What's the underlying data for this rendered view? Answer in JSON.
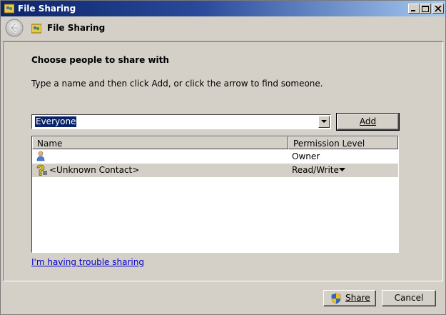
{
  "window": {
    "title": "File Sharing"
  },
  "nav": {
    "title": "File Sharing"
  },
  "content": {
    "heading": "Choose people to share with",
    "instruction": "Type a name and then click Add, or click the arrow to find someone.",
    "combo_value": "Everyone",
    "add_label": "Add"
  },
  "table": {
    "columns": [
      "Name",
      "Permission Level"
    ],
    "rows": [
      {
        "name": "",
        "permission": "Owner",
        "icon": "user-icon"
      },
      {
        "name": "<Unknown Contact>",
        "permission": "Read/Write",
        "icon": "unknown-contact-icon"
      }
    ]
  },
  "help_link": "I'm having trouble sharing",
  "footer": {
    "share_label": "Share",
    "cancel_label": "Cancel"
  }
}
